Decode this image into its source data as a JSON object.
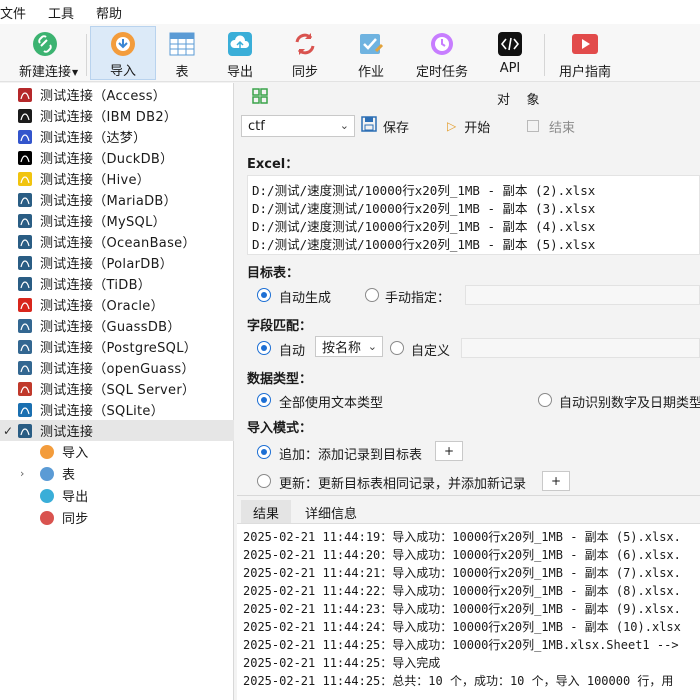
{
  "menu": [
    "文件",
    "工具",
    "帮助"
  ],
  "toolbar": {
    "new_connection": "新建连接",
    "import": "导入",
    "table": "表",
    "export": "导出",
    "sync": "同步",
    "job": "作业",
    "scheduled_task": "定时任务",
    "api": "API",
    "user_guide": "用户指南"
  },
  "tree": {
    "connections": [
      {
        "label": "测试连接（Access）",
        "icon": "access-icon",
        "color": "#b5282a"
      },
      {
        "label": "测试连接（IBM DB2）",
        "icon": "db2-icon",
        "color": "#1b1b1b"
      },
      {
        "label": "测试连接（达梦）",
        "icon": "dameng-icon",
        "color": "#3355cc"
      },
      {
        "label": "测试连接（DuckDB）",
        "icon": "duckdb-icon",
        "color": "#000000"
      },
      {
        "label": "测试连接（Hive）",
        "icon": "hive-icon",
        "color": "#f1c40f"
      },
      {
        "label": "测试连接（MariaDB）",
        "icon": "mariadb-icon",
        "color": "#2a5d84"
      },
      {
        "label": "测试连接（MySQL）",
        "icon": "mysql-icon",
        "color": "#2a5d84"
      },
      {
        "label": "测试连接（OceanBase）",
        "icon": "oceanbase-icon",
        "color": "#2a5d84"
      },
      {
        "label": "测试连接（PolarDB）",
        "icon": "polardb-icon",
        "color": "#2a5d84"
      },
      {
        "label": "测试连接（TiDB）",
        "icon": "tidb-icon",
        "color": "#2a5d84"
      },
      {
        "label": "测试连接（Oracle）",
        "icon": "oracle-icon",
        "color": "#d8261c"
      },
      {
        "label": "测试连接（GuassDB）",
        "icon": "gaussdb-icon",
        "color": "#336791"
      },
      {
        "label": "测试连接（PostgreSQL）",
        "icon": "postgresql-icon",
        "color": "#336791"
      },
      {
        "label": "测试连接（openGuass）",
        "icon": "opengauss-icon",
        "color": "#336791"
      },
      {
        "label": "测试连接（SQL Server）",
        "icon": "sqlserver-icon",
        "color": "#c0392b"
      },
      {
        "label": "测试连接（SQLite）",
        "icon": "sqlite-icon",
        "color": "#1a6fb0"
      },
      {
        "label": "测试连接",
        "icon": "database-icon",
        "color": "#2a5d84"
      }
    ],
    "children": [
      {
        "label": "导入",
        "icon": "import-icon"
      },
      {
        "label": "表",
        "icon": "table-icon"
      },
      {
        "label": "导出",
        "icon": "export-icon"
      },
      {
        "label": "同步",
        "icon": "sync-icon"
      }
    ]
  },
  "import_panel": {
    "object_header": "对    象",
    "connection_select": "ctf",
    "save": "保存",
    "start": "开始",
    "stop": "结束",
    "excel_label": "Excel：",
    "files": [
      "D:/测试/速度测试/10000行x20列_1MB - 副本 (2).xlsx",
      "D:/测试/速度测试/10000行x20列_1MB - 副本 (3).xlsx",
      "D:/测试/速度测试/10000行x20列_1MB - 副本 (4).xlsx",
      "D:/测试/速度测试/10000行x20列_1MB - 副本 (5).xlsx"
    ],
    "target_table_label": "目标表：",
    "auto_generate": "自动生成",
    "manual_specify": "手动指定：",
    "field_match_label": "字段匹配：",
    "auto": "自动",
    "by_name": "按名称",
    "custom": "自定义",
    "data_type_label": "数据类型：",
    "all_text": "全部使用文本类型",
    "auto_detect": "自动识别数字及日期类型",
    "import_mode_label": "导入模式：",
    "append": "追加：添加记录到目标表",
    "update": "更新：更新目标表相同记录，并添加新记录",
    "plus": "+"
  },
  "log": {
    "tab_result": "结果",
    "tab_detail": "详细信息",
    "lines": [
      "2025-02-21 11:44:19：导入成功：10000行x20列_1MB - 副本 (5).xlsx.",
      "2025-02-21 11:44:20：导入成功：10000行x20列_1MB - 副本 (6).xlsx.",
      "2025-02-21 11:44:21：导入成功：10000行x20列_1MB - 副本 (7).xlsx.",
      "2025-02-21 11:44:22：导入成功：10000行x20列_1MB - 副本 (8).xlsx.",
      "2025-02-21 11:44:23：导入成功：10000行x20列_1MB - 副本 (9).xlsx.",
      "2025-02-21 11:44:24：导入成功：10000行x20列_1MB - 副本 (10).xlsx",
      "2025-02-21 11:44:25：导入成功：10000行x20列_1MB.xlsx.Sheet1 -->",
      "2025-02-21 11:44:25：导入完成",
      "2025-02-21 11:44:25：总共：10 个，成功：10 个，导入 100000 行，用"
    ]
  }
}
